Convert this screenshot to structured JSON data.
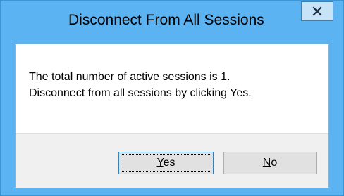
{
  "dialog": {
    "title": "Disconnect From All Sessions",
    "message_line1": "The total number of active sessions is 1.",
    "message_line2": "Disconnect from all sessions by clicking Yes.",
    "yes_accel": "Y",
    "yes_rest": "es",
    "no_accel": "N",
    "no_rest": "o",
    "close_icon": "close-icon"
  },
  "colors": {
    "frame": "#5cb3f2",
    "client_bg": "#ffffff",
    "footer_bg": "#f0f0f0",
    "button_bg": "#e1e1e1"
  }
}
